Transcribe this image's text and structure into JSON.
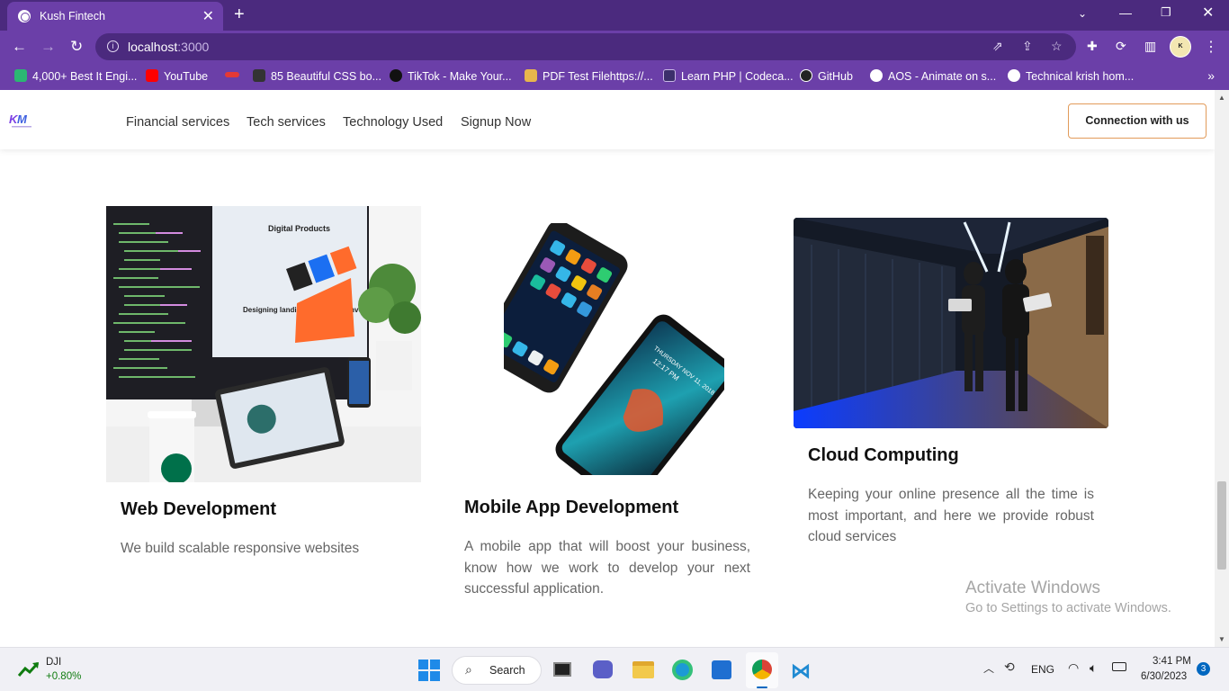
{
  "browser": {
    "tab_title": "Kush Fintech",
    "tab_close": "✕",
    "new_tab": "+",
    "url_host": "localhost",
    "url_port": ":3000",
    "bookmarks": [
      {
        "label": "4,000+ Best It Engi...",
        "color": "#2bb673"
      },
      {
        "label": "YouTube",
        "color": "#ff0000"
      },
      {
        "label": "",
        "color": "#e53935"
      },
      {
        "label": "85 Beautiful CSS bo...",
        "color": "#333333"
      },
      {
        "label": "TikTok - Make Your...",
        "color": "#111111"
      },
      {
        "label": "PDF Test Filehttps://...",
        "color": "#e8b64c"
      },
      {
        "label": "Learn PHP | Codeca...",
        "color": "#3b2f6b"
      },
      {
        "label": "GitHub",
        "color": "#222222"
      },
      {
        "label": "AOS - Animate on s...",
        "color": "#ffffff"
      },
      {
        "label": "Technical krish hom...",
        "color": "#ffffff"
      }
    ],
    "avatar_text": "K TECHNICAL"
  },
  "header": {
    "nav": [
      "Financial services",
      "Tech services",
      "Technology Used",
      "Signup Now"
    ],
    "cta_label": "Connection with us"
  },
  "cards": [
    {
      "title": "Web Development",
      "text": "We build scalable responsive websites",
      "image": "desktop-workspace-photo"
    },
    {
      "title": "Mobile App Development",
      "text": "A mobile app that will boost your business, know how we work to develop your next successful application.",
      "image": "smartphones-photo"
    },
    {
      "title": "Cloud Computing",
      "text": "Keeping your online presence all the time is most important, and here we provide robust cloud services",
      "image": "data-center-photo"
    }
  ],
  "image_text": {
    "digital_products": "Digital Products",
    "landing_pages": "Designing landing pages for conversion",
    "phone_date": "THURSDAY NOV 11, 2018",
    "phone_time": "12:17 PM"
  },
  "watermark": {
    "title": "Activate Windows",
    "subtitle": "Go to Settings to activate Windows."
  },
  "taskbar": {
    "stock_name": "DJI",
    "stock_change": "+0.80%",
    "search_label": "Search",
    "lang": "ENG",
    "time": "3:41 PM",
    "date": "6/30/2023",
    "notifications": "3"
  },
  "colors": {
    "tab_strip": "#4b2a7e",
    "toolbar": "#6b3fa8",
    "cta_border": "#e29b5a",
    "stock_up": "#107c10",
    "notify_badge": "#0067c0"
  }
}
